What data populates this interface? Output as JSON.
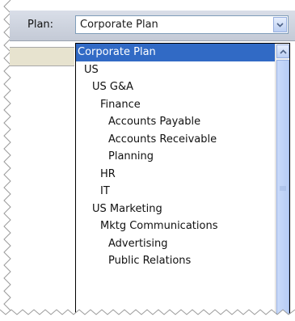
{
  "plan_selector": {
    "label": "Plan:",
    "selected_value": "Corporate Plan"
  },
  "dropdown": {
    "items": [
      {
        "label": "Corporate Plan",
        "selected": true
      },
      {
        "label": "US"
      },
      {
        "label": "US G&A"
      },
      {
        "label": "Finance"
      },
      {
        "label": "Accounts Payable"
      },
      {
        "label": "Accounts Receivable"
      },
      {
        "label": "Planning"
      },
      {
        "label": "HR"
      },
      {
        "label": "IT"
      },
      {
        "label": "US Marketing"
      },
      {
        "label": "Mktg Communications"
      },
      {
        "label": "Advertising"
      },
      {
        "label": "Public Relations"
      }
    ]
  },
  "colors": {
    "selection": "#316ac5",
    "toolbar": "#c9ceda",
    "combo_border": "#7f9db9"
  }
}
